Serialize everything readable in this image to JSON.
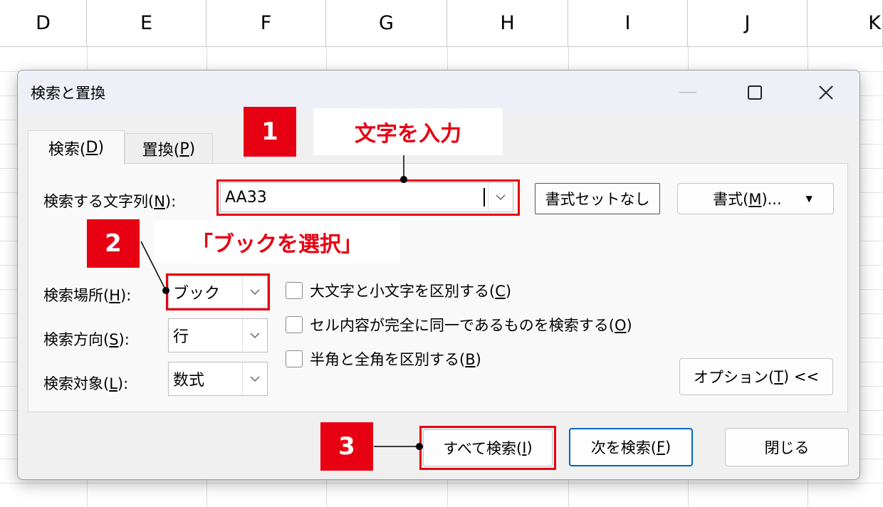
{
  "spreadsheet": {
    "columns": [
      "D",
      "E",
      "F",
      "G",
      "H",
      "I",
      "J",
      "K"
    ]
  },
  "dialog": {
    "title": "検索と置換",
    "tabs": [
      {
        "label": "検索(",
        "key": "D",
        "suffix": ")"
      },
      {
        "label": "置換(",
        "key": "P",
        "suffix": ")"
      }
    ],
    "find_what": {
      "label": "検索する文字列(",
      "key": "N",
      "suffix": "):",
      "value": "AA33"
    },
    "no_format_button": "書式セットなし",
    "format_button": {
      "label": "書式(",
      "key": "M",
      "suffix": ")..."
    },
    "within": {
      "label": "検索場所(",
      "key": "H",
      "suffix": "):",
      "value": "ブック"
    },
    "search": {
      "label": "検索方向(",
      "key": "S",
      "suffix": "):",
      "value": "行"
    },
    "look_in": {
      "label": "検索対象(",
      "key": "L",
      "suffix": "):",
      "value": "数式"
    },
    "options": [
      {
        "label": "大文字と小文字を区別する(",
        "key": "C",
        "suffix": ")",
        "checked": false
      },
      {
        "label": "セル内容が完全に同一であるものを検索する(",
        "key": "O",
        "suffix": ")",
        "checked": false
      },
      {
        "label": "半角と全角を区別する(",
        "key": "B",
        "suffix": ")",
        "checked": false
      }
    ],
    "options_button": {
      "label": "オプション(",
      "key": "T",
      "suffix": ") <<"
    },
    "find_all_button": {
      "label": "すべて検索(",
      "key": "I",
      "suffix": ")"
    },
    "find_next_button": {
      "label": "次を検索(",
      "key": "F",
      "suffix": ")"
    },
    "close_button": "閉じる"
  },
  "annotations": [
    {
      "number": "1",
      "text": "文字を入力"
    },
    {
      "number": "2",
      "text": "「ブックを選択」"
    },
    {
      "number": "3",
      "text": ""
    }
  ],
  "colors": {
    "accent_red": "#e60012",
    "focus_blue": "#0067c0"
  }
}
